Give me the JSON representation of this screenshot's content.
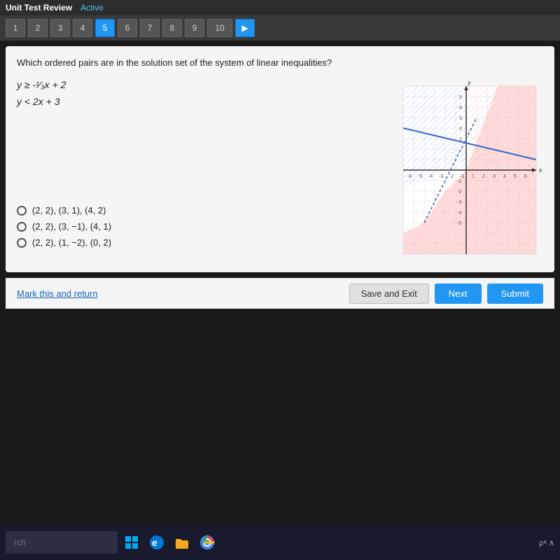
{
  "topbar": {
    "title": "Unit Test Review",
    "status": "Active"
  },
  "navbar": {
    "buttons": [
      {
        "label": "1",
        "active": false
      },
      {
        "label": "2",
        "active": false
      },
      {
        "label": "3",
        "active": false
      },
      {
        "label": "4",
        "active": false
      },
      {
        "label": "5",
        "active": true
      },
      {
        "label": "6",
        "active": false
      },
      {
        "label": "7",
        "active": false
      },
      {
        "label": "8",
        "active": false
      },
      {
        "label": "9",
        "active": false
      },
      {
        "label": "10",
        "active": false,
        "wide": true
      }
    ],
    "next_arrow": "▶"
  },
  "question": {
    "text": "Which ordered pairs are in the solution set of the system of linear inequalities?",
    "equation1": "y ≥ -¹⁄₃x + 2",
    "equation2": "y < 2x + 3"
  },
  "options": [
    {
      "label": "(2, 2), (3, 1), (4, 2)"
    },
    {
      "label": "(2, 2), (3, −1), (4, 1)"
    },
    {
      "label": "(2, 2), (1, −2), (0, 2)"
    }
  ],
  "buttons": {
    "mark": "Mark this and return",
    "save": "Save and Exit",
    "next": "Next",
    "submit": "Submit"
  },
  "taskbar": {
    "search_placeholder": "rch",
    "systray_text": "ρ⁸  ∧"
  },
  "graph": {
    "x_labels": [
      "-6",
      "-5",
      "-4",
      "-3",
      "-2",
      "-1",
      "1",
      "2",
      "3",
      "4",
      "5",
      "6"
    ],
    "y_labels": [
      "-5",
      "-4",
      "-3",
      "-2",
      "-1",
      "1",
      "2",
      "3",
      "4",
      "5"
    ]
  }
}
